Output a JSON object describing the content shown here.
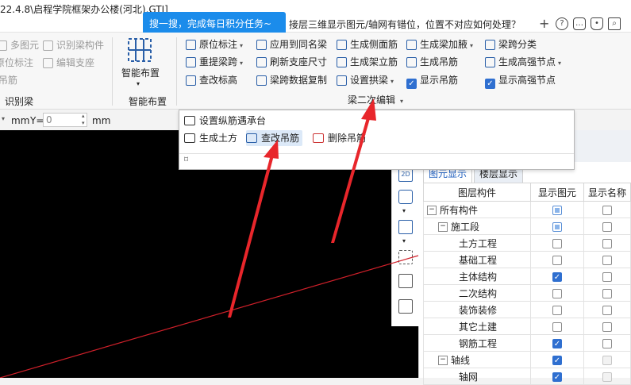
{
  "window": {
    "title": "22.4.8\\启程学院框架办公楼(河北).GTJ]"
  },
  "tip": {
    "text": "搜一搜，完成每日积分任务~"
  },
  "search": {
    "question": "接层三维显示图元/轴网有错位，位置不对应如何处理？"
  },
  "title_icons": [
    "add-icon",
    "help-icon",
    "message-icon",
    "bell-icon",
    "search-icon"
  ],
  "ribbon": {
    "left_partial": {
      "items": [
        "多图元",
        "识别梁构件",
        "原位标注",
        "编辑支座",
        "吊筋"
      ],
      "group_label": "识别梁"
    },
    "smart": {
      "button": "智能布置",
      "group_label": "智能布置"
    },
    "edit_group": {
      "col1": [
        "原位标注",
        "重提梁跨",
        "查改标高"
      ],
      "col2": [
        "应用到同名梁",
        "刷新支座尺寸",
        "梁跨数据复制"
      ],
      "col3": [
        "生成侧面筋",
        "生成架立筋",
        "设置拱梁"
      ],
      "col4": [
        "生成梁加腋",
        "生成吊筋",
        "显示吊筋"
      ],
      "col5": [
        "梁跨分类",
        "生成高强节点",
        "显示高强节点"
      ],
      "group_label": "梁二次编辑"
    }
  },
  "coords": {
    "x_unit": "mm",
    "y_label": "Y=",
    "y_value": "0",
    "y_unit": "mm"
  },
  "popup": {
    "item1": "设置纵筋遇承台",
    "item2": "生成土方",
    "item3": "查改吊筋",
    "item4": "删除吊筋"
  },
  "layer_panel": {
    "tabs": [
      "图元显示",
      "楼层显示"
    ],
    "columns": [
      "图层构件",
      "显示图元",
      "显示名称"
    ],
    "rows": [
      {
        "name": "所有构件",
        "level": 0,
        "toggle": "−",
        "show": "part",
        "label": "off"
      },
      {
        "name": "施工段",
        "level": 1,
        "toggle": "−",
        "show": "part",
        "label": "off"
      },
      {
        "name": "土方工程",
        "level": 2,
        "toggle": "",
        "show": "off",
        "label": "off"
      },
      {
        "name": "基础工程",
        "level": 2,
        "toggle": "",
        "show": "off",
        "label": "off"
      },
      {
        "name": "主体结构",
        "level": 2,
        "toggle": "",
        "show": "on",
        "label": "off"
      },
      {
        "name": "二次结构",
        "level": 2,
        "toggle": "",
        "show": "off",
        "label": "off"
      },
      {
        "name": "装饰装修",
        "level": 2,
        "toggle": "",
        "show": "off",
        "label": "off"
      },
      {
        "name": "其它土建",
        "level": 2,
        "toggle": "",
        "show": "off",
        "label": "off"
      },
      {
        "name": "钢筋工程",
        "level": 2,
        "toggle": "",
        "show": "on",
        "label": "off"
      },
      {
        "name": "轴线",
        "level": 1,
        "toggle": "−",
        "show": "on",
        "label": "dis"
      },
      {
        "name": "轴网",
        "level": 2,
        "toggle": "",
        "show": "on",
        "label": "dis"
      }
    ]
  },
  "colors": {
    "accent": "#1b8ceb",
    "canvas": "#000000",
    "annotation_arrow": "#e8262b",
    "axis_line": "#d0202a"
  }
}
